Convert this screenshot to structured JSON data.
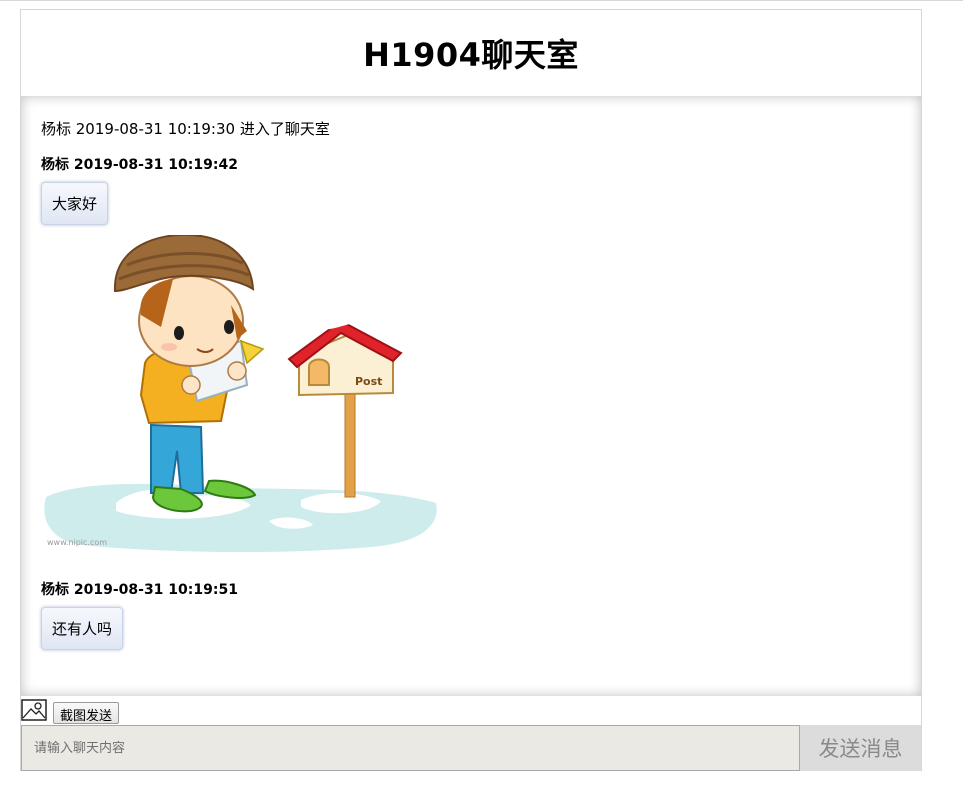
{
  "header": {
    "title": "H1904聊天室"
  },
  "messages": {
    "system_notice": "杨标 2019-08-31 10:19:30 进入了聊天室",
    "items": [
      {
        "meta": "杨标 2019-08-31 10:19:42",
        "text": "大家好"
      },
      {
        "meta": "杨标 2019-08-31 10:19:51",
        "text": "还有人吗"
      }
    ],
    "image_caption": "www.nipic.com"
  },
  "toolbar": {
    "image_icon": "image-icon",
    "screenshot_label": "截图发送"
  },
  "composer": {
    "placeholder": "请输入聊天内容",
    "send_label": "发送消息"
  }
}
